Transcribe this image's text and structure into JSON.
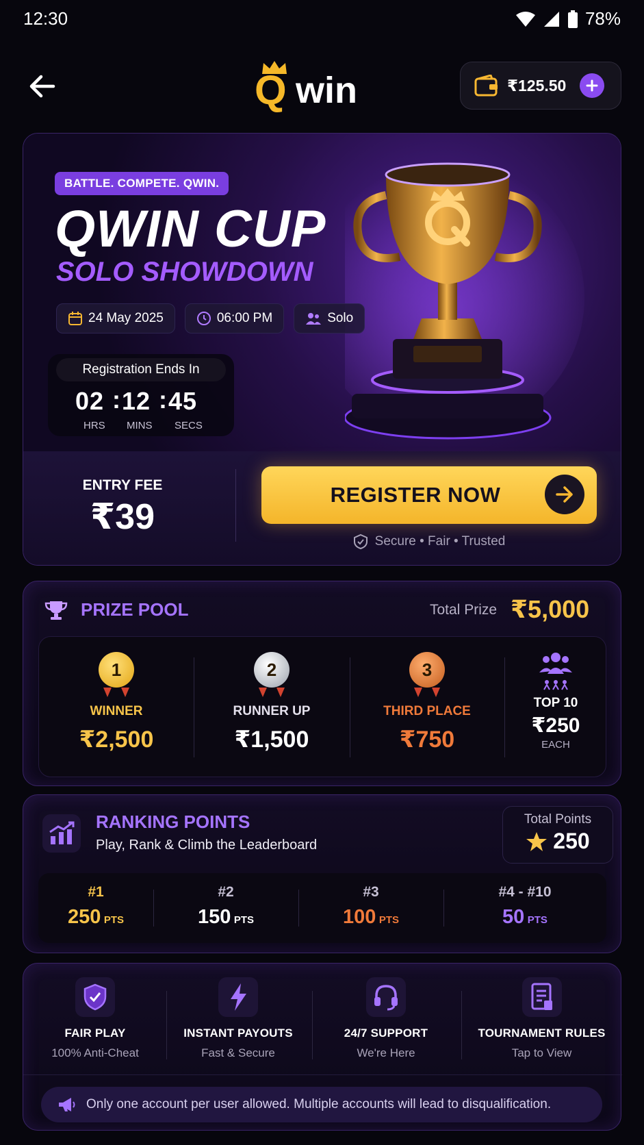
{
  "status_bar": {
    "time": "12:30",
    "battery": "78%"
  },
  "header": {
    "brand": "win",
    "brand_q": "Q",
    "wallet_balance": "₹125.50"
  },
  "hero": {
    "tagline": "BATTLE. COMPETE. QWIN.",
    "title": "QWIN CUP",
    "subtitle": "SOLO SHOWDOWN",
    "date": "24 May 2025",
    "time": "06:00 PM",
    "mode": "Solo",
    "registration_label": "Registration Ends In",
    "countdown": {
      "hrs": "02",
      "mins": "12",
      "secs": "45",
      "hrs_label": "HRS",
      "mins_label": "MINS",
      "secs_label": "SECS",
      "sep": ":"
    },
    "entry_fee_label": "ENTRY FEE",
    "entry_fee": "₹39",
    "register_label": "REGISTER NOW",
    "secure_text": "Secure • Fair • Trusted"
  },
  "prize_pool": {
    "title": "PRIZE POOL",
    "total_label": "Total Prize",
    "total_value": "₹5,000",
    "places": [
      {
        "medal": "1",
        "label": "WINNER",
        "amount": "₹2,500",
        "color": "#f7c44a"
      },
      {
        "medal": "2",
        "label": "RUNNER UP",
        "amount": "₹1,500",
        "color": "#ffffff"
      },
      {
        "medal": "3",
        "label": "THIRD PLACE",
        "amount": "₹750",
        "color": "#f07a3a"
      },
      {
        "medal": "",
        "label": "TOP 10",
        "amount": "₹250",
        "sub": "EACH",
        "color": "#ffffff"
      }
    ]
  },
  "ranking": {
    "title": "RANKING POINTS",
    "subtitle": "Play, Rank & Climb the Leaderboard",
    "total_label": "Total Points",
    "total_value": "250",
    "unit": "PTS",
    "tiers": [
      {
        "rank": "#1",
        "points": "250",
        "color": "#f7c44a"
      },
      {
        "rank": "#2",
        "points": "150",
        "color": "#ffffff"
      },
      {
        "rank": "#3",
        "points": "100",
        "color": "#f07a3a"
      },
      {
        "rank": "#4 - #10",
        "points": "50",
        "color": "#a574ff"
      }
    ]
  },
  "features": [
    {
      "title": "FAIR PLAY",
      "sub": "100% Anti-Cheat",
      "icon": "shield-check-icon"
    },
    {
      "title": "INSTANT PAYOUTS",
      "sub": "Fast & Secure",
      "icon": "lightning-icon"
    },
    {
      "title": "24/7 SUPPORT",
      "sub": "We're Here",
      "icon": "headset-icon"
    },
    {
      "title": "TOURNAMENT RULES",
      "sub": "Tap to View",
      "icon": "document-icon"
    }
  ],
  "notice": "Only one account per user allowed. Multiple accounts will lead to disqualification.",
  "colors": {
    "accent_purple": "#a574ff",
    "gold": "#f7c44a",
    "bronze": "#f07a3a",
    "background": "#07060d"
  }
}
